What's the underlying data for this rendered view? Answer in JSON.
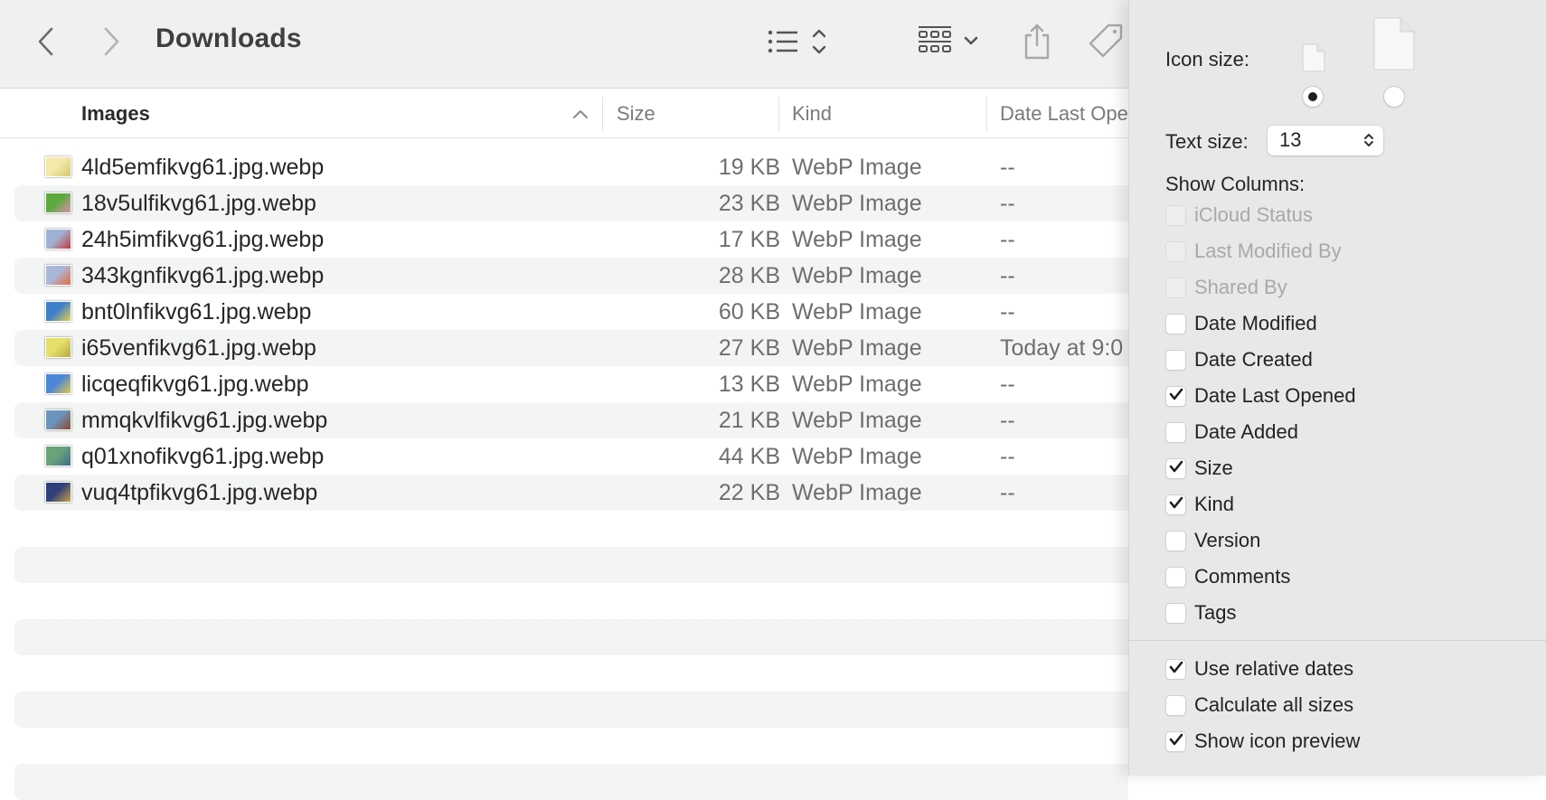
{
  "window": {
    "title": "Downloads",
    "toolbar": {
      "back": "back",
      "forward": "forward",
      "view_mode": "list-view",
      "group": "group-by",
      "share": "share",
      "tags": "tags"
    }
  },
  "columns": {
    "name": "Images",
    "size": "Size",
    "kind": "Kind",
    "date": "Date Last Ope",
    "sort": "ascending"
  },
  "files": [
    {
      "name": "4ld5emfikvg61.jpg.webp",
      "size": "19 KB",
      "kind": "WebP Image",
      "date": "--",
      "thumb": [
        "#f3e9a8",
        "#d8c86a"
      ]
    },
    {
      "name": "18v5ulfikvg61.jpg.webp",
      "size": "23 KB",
      "kind": "WebP Image",
      "date": "--",
      "thumb": [
        "#5caa3c",
        "#d98fb0"
      ]
    },
    {
      "name": "24h5imfikvg61.jpg.webp",
      "size": "17 KB",
      "kind": "WebP Image",
      "date": "--",
      "thumb": [
        "#9fb2d6",
        "#c23a3a"
      ]
    },
    {
      "name": "343kgnfikvg61.jpg.webp",
      "size": "28 KB",
      "kind": "WebP Image",
      "date": "--",
      "thumb": [
        "#aab8d8",
        "#e8693a"
      ]
    },
    {
      "name": "bnt0lnfikvg61.jpg.webp",
      "size": "60 KB",
      "kind": "WebP Image",
      "date": "--",
      "thumb": [
        "#3f7ec9",
        "#e7d34e"
      ]
    },
    {
      "name": "i65venfikvg61.jpg.webp",
      "size": "27 KB",
      "kind": "WebP Image",
      "date": "Today at 9:0",
      "thumb": [
        "#e6df6c",
        "#b5a83a"
      ]
    },
    {
      "name": "licqeqfikvg61.jpg.webp",
      "size": "13 KB",
      "kind": "WebP Image",
      "date": "--",
      "thumb": [
        "#4c86d8",
        "#e1c94a"
      ]
    },
    {
      "name": "mmqkvlfikvg61.jpg.webp",
      "size": "21 KB",
      "kind": "WebP Image",
      "date": "--",
      "thumb": [
        "#6c95bd",
        "#8b4a2e"
      ]
    },
    {
      "name": "q01xnofikvg61.jpg.webp",
      "size": "44 KB",
      "kind": "WebP Image",
      "date": "--",
      "thumb": [
        "#6aa37a",
        "#3c6e89"
      ]
    },
    {
      "name": "vuq4tpfikvg61.jpg.webp",
      "size": "22 KB",
      "kind": "WebP Image",
      "date": "--",
      "thumb": [
        "#2e3f7a",
        "#c9a04a"
      ]
    }
  ],
  "panel": {
    "icon_size_label": "Icon size:",
    "icon_size_selected": "small",
    "text_size_label": "Text size:",
    "text_size_value": "13",
    "show_columns_label": "Show Columns:",
    "columns": [
      {
        "label": "iCloud Status",
        "checked": false,
        "enabled": false
      },
      {
        "label": "Last Modified By",
        "checked": false,
        "enabled": false
      },
      {
        "label": "Shared By",
        "checked": false,
        "enabled": false
      },
      {
        "label": "Date Modified",
        "checked": false,
        "enabled": true
      },
      {
        "label": "Date Created",
        "checked": false,
        "enabled": true
      },
      {
        "label": "Date Last Opened",
        "checked": true,
        "enabled": true
      },
      {
        "label": "Date Added",
        "checked": false,
        "enabled": true
      },
      {
        "label": "Size",
        "checked": true,
        "enabled": true
      },
      {
        "label": "Kind",
        "checked": true,
        "enabled": true
      },
      {
        "label": "Version",
        "checked": false,
        "enabled": true
      },
      {
        "label": "Comments",
        "checked": false,
        "enabled": true
      },
      {
        "label": "Tags",
        "checked": false,
        "enabled": true
      }
    ],
    "options": [
      {
        "label": "Use relative dates",
        "checked": true
      },
      {
        "label": "Calculate all sizes",
        "checked": false
      },
      {
        "label": "Show icon preview",
        "checked": true
      }
    ]
  }
}
